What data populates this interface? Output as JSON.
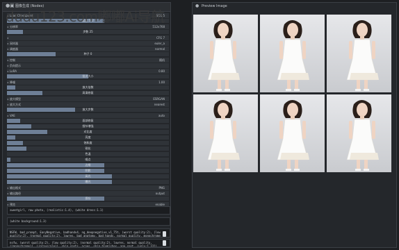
{
  "watermark": "dudu123.com嘟嘟Ai导航",
  "left_panel": {
    "title": "图像生成 (Nodes)",
    "rows": [
      {
        "type": "row",
        "label": "Load Checkpoint",
        "value": "SD1.5"
      },
      {
        "type": "slider",
        "label": "宽度 512",
        "fill": 0.6
      },
      {
        "type": "row",
        "label": "分辨率",
        "value": "512x768"
      },
      {
        "type": "slider",
        "label": "步数 25",
        "fill": 0.1
      },
      {
        "type": "row",
        "label": "",
        "value": "CFG 7"
      },
      {
        "type": "row",
        "label": "采样器",
        "value": "euler_a"
      },
      {
        "type": "row",
        "label": "调度器",
        "value": "normal"
      },
      {
        "type": "slider",
        "label": "种子 0",
        "fill": 0.3
      },
      {
        "type": "row",
        "label": "控制",
        "value": "随机"
      },
      {
        "type": "row",
        "label": "负向提示",
        "value": ""
      },
      {
        "type": "row",
        "label": "LoRA",
        "value": "0.80"
      },
      {
        "type": "slider",
        "label": "批次大小",
        "fill": 0.5
      },
      {
        "type": "row",
        "label": "降噪",
        "value": "1.00"
      },
      {
        "type": "slider",
        "label": "放大倍数",
        "fill": 0.05
      },
      {
        "type": "slider",
        "label": "高清修复",
        "fill": 0.22
      },
      {
        "type": "row",
        "label": "放大模型",
        "value": "ESRGAN"
      },
      {
        "type": "row",
        "label": "放大方式",
        "value": "nearest"
      },
      {
        "type": "slider",
        "label": "放大步数",
        "fill": 0.42
      },
      {
        "type": "row",
        "label": "VAE",
        "value": "auto"
      },
      {
        "type": "slider",
        "label": "面部修复",
        "fill": 0.08
      },
      {
        "type": "slider",
        "label": "细节增强",
        "fill": 0.15
      },
      {
        "type": "slider",
        "label": "对比度",
        "fill": 0.25
      },
      {
        "type": "slider",
        "label": "亮度",
        "fill": 0.05
      },
      {
        "type": "slider",
        "label": "饱和度",
        "fill": 0.1
      },
      {
        "type": "slider",
        "label": "锐化",
        "fill": 0.12
      },
      {
        "type": "slider",
        "label": "色温",
        "fill": 0.0
      },
      {
        "type": "slider",
        "label": "噪点",
        "fill": 0.02
      },
      {
        "type": "slider",
        "label": "边缘",
        "fill": 0.6
      },
      {
        "type": "slider",
        "label": "阴影",
        "fill": 0.6
      },
      {
        "type": "slider",
        "label": "高光",
        "fill": 0.65
      },
      {
        "type": "slider",
        "label": "曝光",
        "fill": 0.65
      },
      {
        "type": "row",
        "label": "输出格式",
        "value": "PNG"
      },
      {
        "type": "row",
        "label": "输出路径",
        "value": "output"
      },
      {
        "type": "slider",
        "label": "保存",
        "fill": 0.6
      },
      {
        "type": "row",
        "label": "预览",
        "value": "enable"
      }
    ],
    "prompt_positive": "sweetgirl, raw photo, (realistic:1.4), (white dress:1.1)",
    "prompt_second": "(white background:1.3)",
    "prompt_negative": "NSFW, bad_prompt, EasyNegative, badhandv4, ng_deepnegative_v1_75t, (worst quality:2), (low quality:2), (normal quality:2), lowres, bad anatomy, bad hands, normal quality, monochrome",
    "prompt_negative2": "nsfw, (worst quality:2), (low quality:2), (normal quality:2), lowres, normal quality, ((monochrome)), ((grayscale)), skin spots, acnes, skin blemishes, age spot, (ugly:1.331), (duplicate:1.331), bad hands"
  },
  "right_panel": {
    "title": "Preview Image"
  },
  "colors": {
    "accent": "#6e7f96",
    "panel": "#24272b",
    "background": "#1d1f22"
  }
}
